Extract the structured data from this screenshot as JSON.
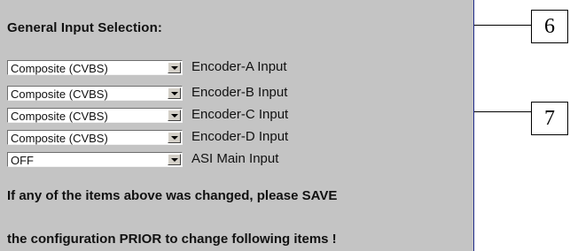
{
  "panel": {
    "title": "General Input Selection:",
    "colors": {
      "panel_bg": "#c4c4c4",
      "panel_border": "#1f2a8a"
    }
  },
  "inputs": [
    {
      "value": "Composite (CVBS)",
      "label": "Encoder-A Input"
    },
    {
      "value": "Composite (CVBS)",
      "label": "Encoder-B Input"
    },
    {
      "value": "Composite (CVBS)",
      "label": "Encoder-C Input"
    },
    {
      "value": "Composite (CVBS)",
      "label": "Encoder-D Input"
    },
    {
      "value": "OFF",
      "label": "ASI Main Input"
    }
  ],
  "notes": {
    "line1": "If any of the items above was changed, please SAVE",
    "line2": "the configuration PRIOR to change following items !"
  },
  "callouts": [
    "6",
    "7"
  ]
}
